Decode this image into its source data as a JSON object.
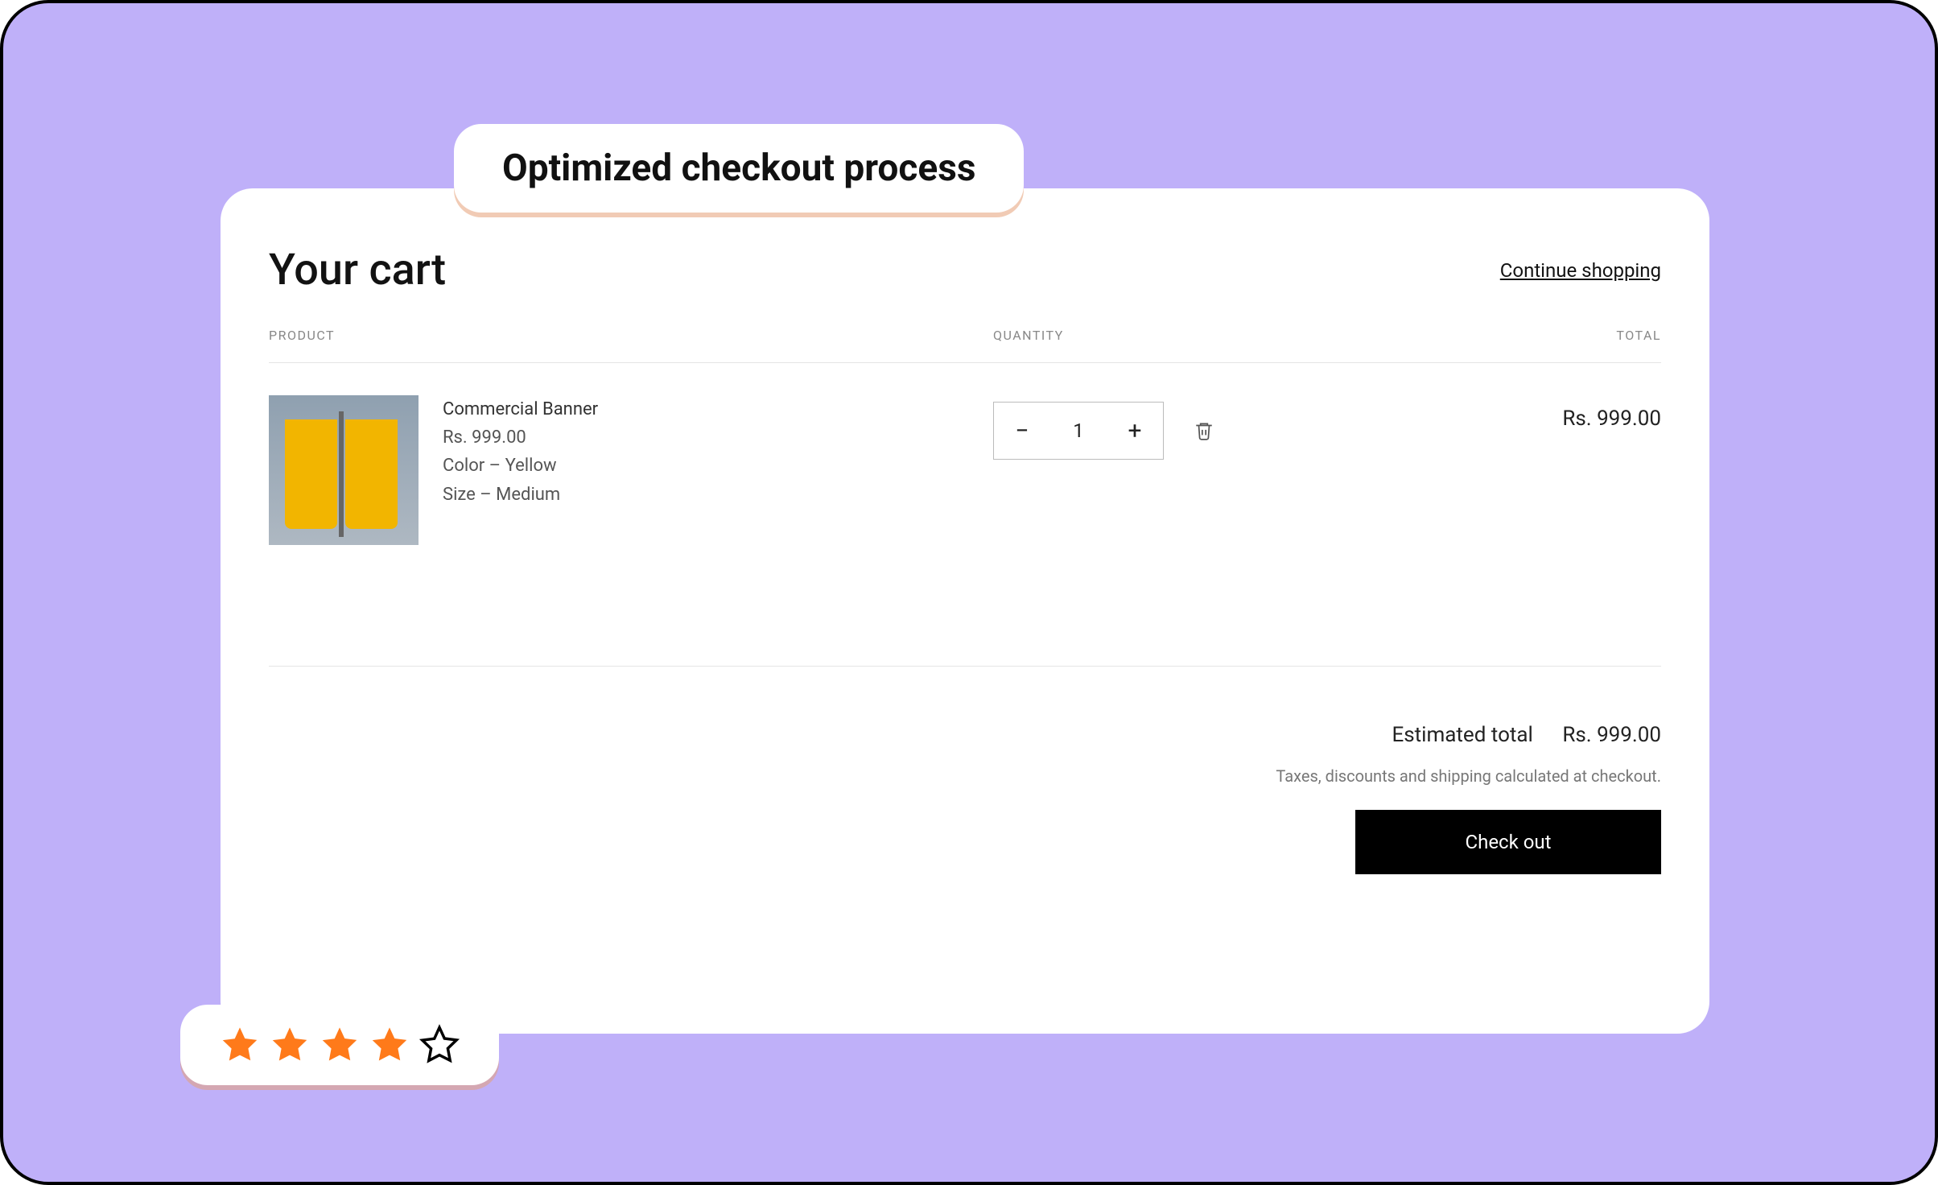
{
  "callout": {
    "title": "Optimized checkout process"
  },
  "cart": {
    "title": "Your cart",
    "continue": "Continue shopping",
    "headers": {
      "product": "PRODUCT",
      "quantity": "QUANTITY",
      "total": "TOTAL"
    },
    "item": {
      "name": "Commercial Banner",
      "price": "Rs. 999.00",
      "color": "Color – Yellow",
      "size": "Size – Medium",
      "qty": "1",
      "line_total": "Rs. 999.00"
    },
    "summary": {
      "estimated_label": "Estimated total",
      "estimated_value": "Rs. 999.00",
      "tax_note": "Taxes, discounts and shipping calculated at checkout.",
      "checkout": "Check out"
    }
  },
  "rating": {
    "filled": 4,
    "total": 5
  }
}
